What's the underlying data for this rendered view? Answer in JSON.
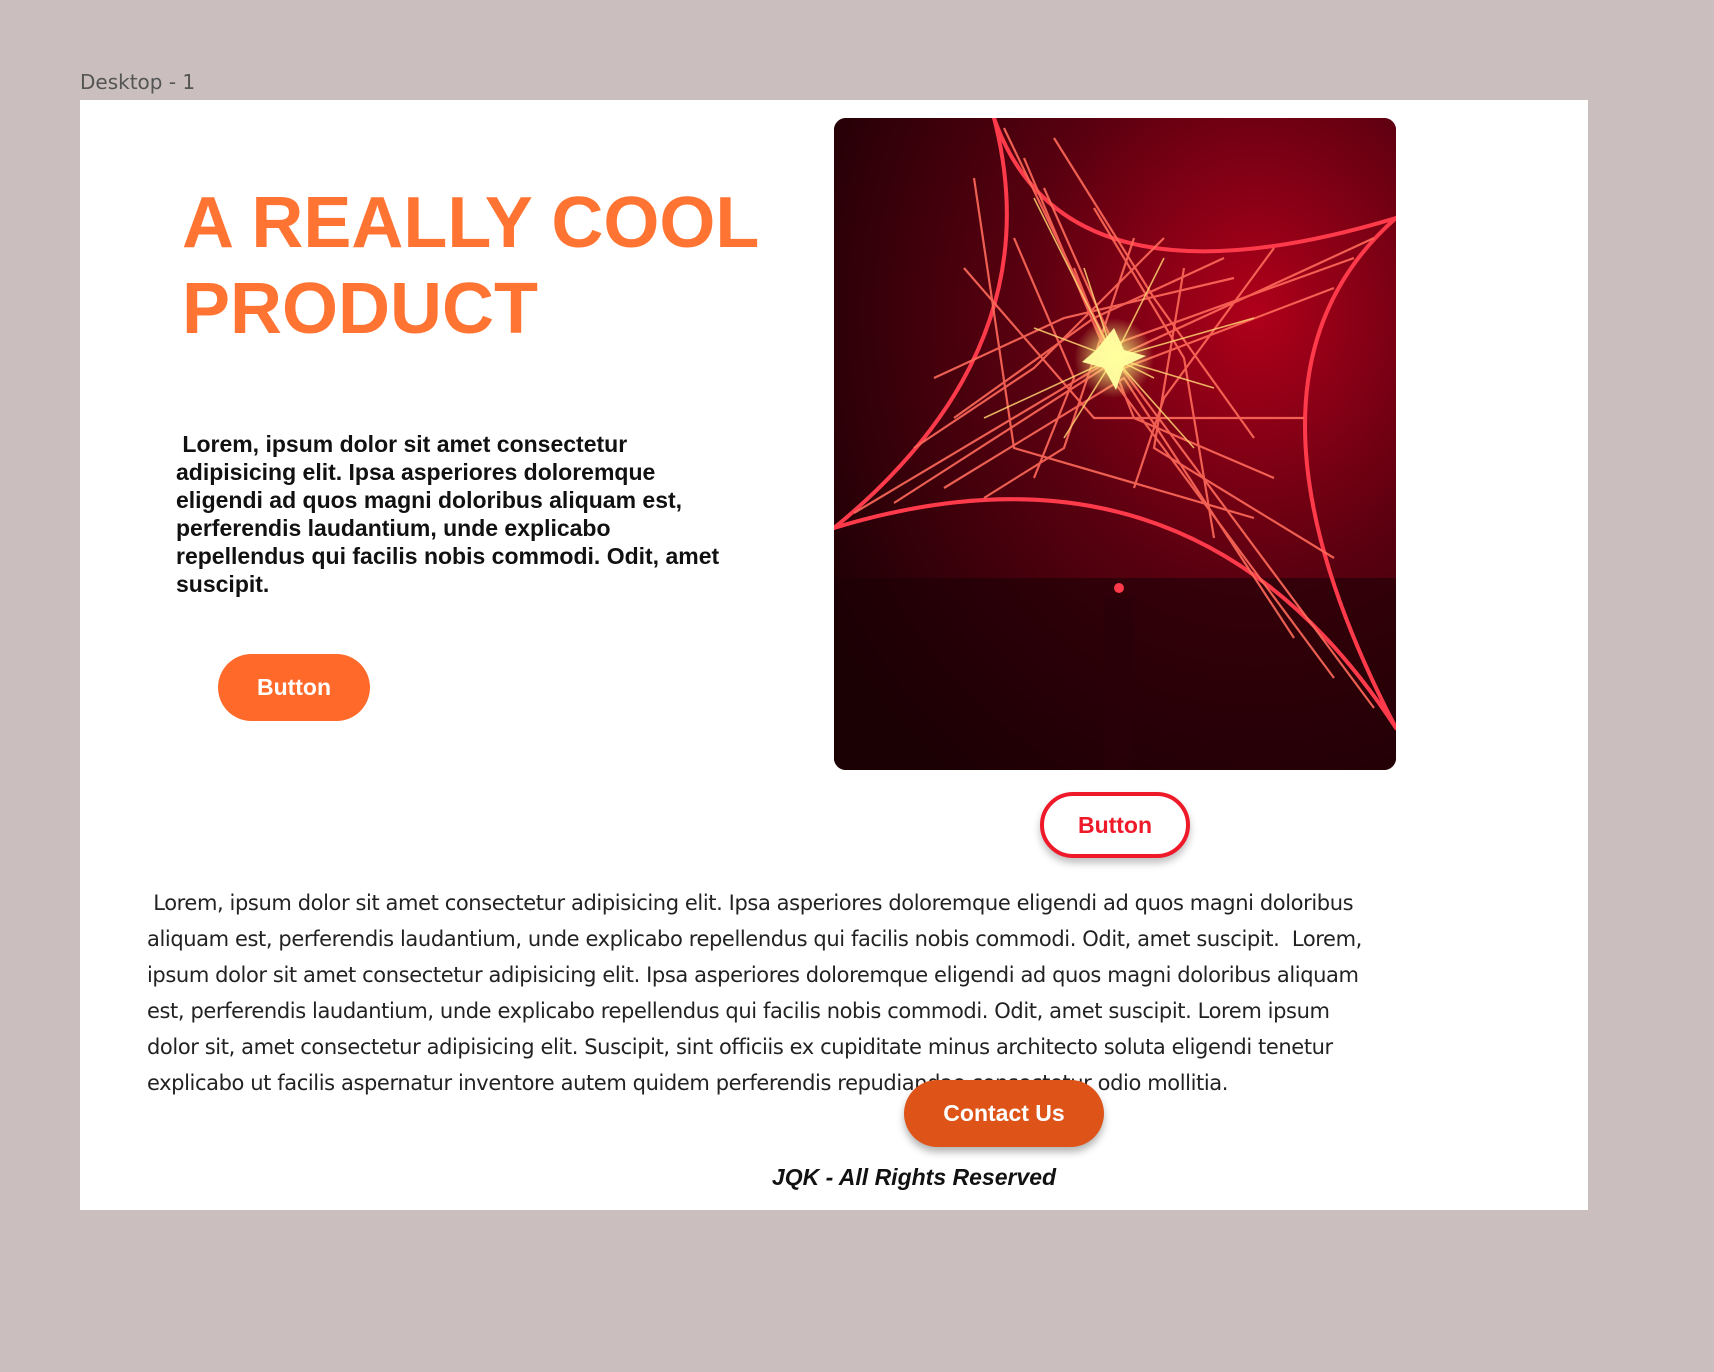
{
  "canvas": {
    "frame_label": "Desktop - 1"
  },
  "hero": {
    "title": "A REALLY COOL PRODUCT",
    "description": " Lorem, ipsum dolor sit amet consectetur adipisicing elit. Ipsa asperiores doloremque eligendi ad quos magni doloribus aliquam est, perferendis laudantium, unde explicabo repellendus qui facilis nobis commodi. Odit, amet suscipit.",
    "primary_button": "Button",
    "image_icon": "product-image",
    "secondary_button": "Button"
  },
  "content": {
    "body": " Lorem, ipsum dolor sit amet consectetur adipisicing elit. Ipsa asperiores doloremque eligendi ad quos magni doloribus aliquam est, perferendis laudantium, unde explicabo repellendus qui facilis nobis commodi. Odit, amet suscipit.  Lorem, ipsum dolor sit amet consectetur adipisicing elit. Ipsa asperiores doloremque eligendi ad quos magni doloribus aliquam est, perferendis laudantium, unde explicabo repellendus qui facilis nobis commodi. Odit, amet suscipit. Lorem ipsum dolor sit, amet consectetur adipisicing elit. Suscipit, sint officiis ex cupiditate minus architecto soluta eligendi tenetur explicabo ut facilis aspernatur inventore autem quidem perferendis repudiandae consectetur odio mollitia.",
    "contact_button": "Contact Us"
  },
  "footer": {
    "text": "JQK - All Rights Reserved"
  },
  "colors": {
    "canvas_bg": "#cabebe",
    "title_orange": "#ff7433",
    "primary_button": "#ff6a2b",
    "outline_red": "#ee1a2a",
    "contact_button": "#de5418"
  }
}
